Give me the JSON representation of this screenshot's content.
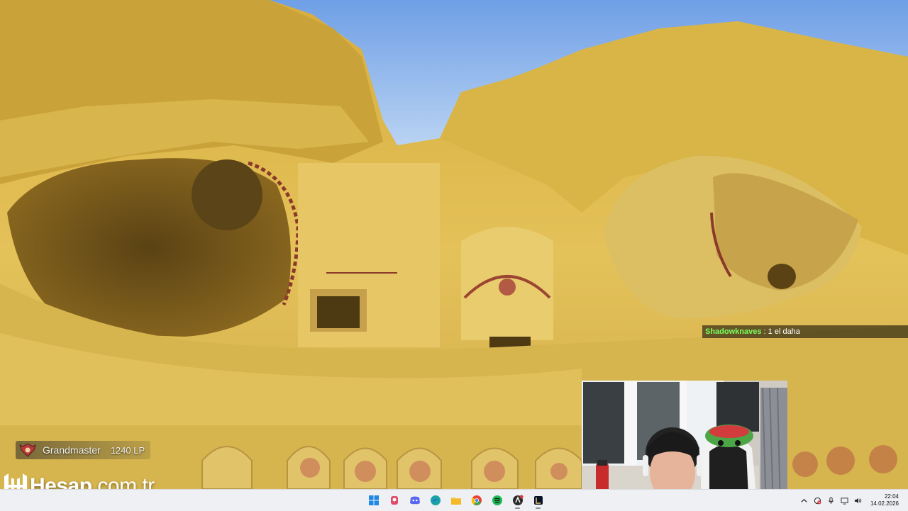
{
  "chat": {
    "username": "Shadowknaves",
    "separator": " : ",
    "message": "1 el daha"
  },
  "rank": {
    "tier": "Grandmaster",
    "lp": "1240 LP",
    "icon": "grandmaster-emblem-icon"
  },
  "brand": {
    "name": "Hesap",
    "tld": ".com.tr"
  },
  "taskbar": {
    "apps": [
      {
        "name": "windows-start-icon",
        "color": "#1e88e5"
      },
      {
        "name": "game-launcher-icon",
        "color": "#e24a6a"
      },
      {
        "name": "discord-icon",
        "color": "#5865f2"
      },
      {
        "name": "edge-icon",
        "color": "#1aa3a3"
      },
      {
        "name": "file-explorer-icon",
        "color": "#f2c94c"
      },
      {
        "name": "chrome-icon",
        "color": "#34a853"
      },
      {
        "name": "spotify-icon",
        "color": "#1db954"
      },
      {
        "name": "riot-client-icon",
        "color": "#d13639"
      },
      {
        "name": "league-of-legends-icon",
        "color": "#c8aa6e"
      }
    ],
    "tray": [
      "chevron-up-icon",
      "network-blocked-icon",
      "microphone-icon",
      "display-icon",
      "volume-icon"
    ],
    "time": "22:04",
    "date": "14.02.2026"
  }
}
